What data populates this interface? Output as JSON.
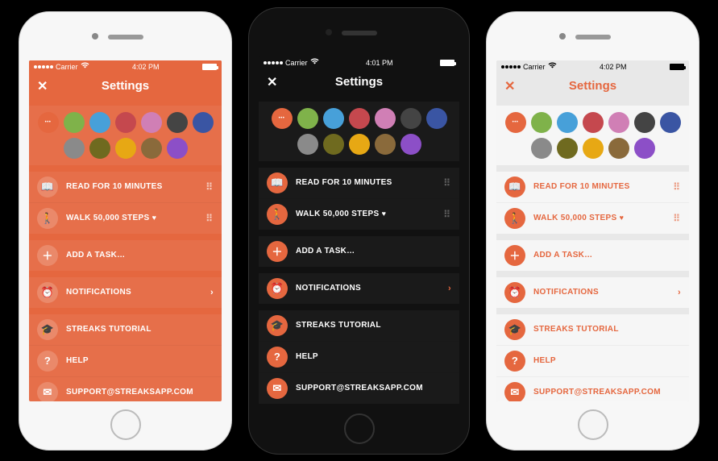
{
  "status": {
    "carrier": "Carrier",
    "wifi_icon": "wifi-icon",
    "battery_icon": "battery-icon"
  },
  "times": {
    "p1": "4:02 PM",
    "p2": "4:01 PM",
    "p3": "4:02 PM"
  },
  "header": {
    "title": "Settings",
    "close_icon": "close-icon"
  },
  "colors": {
    "swatches": [
      {
        "hex": "#e5673f",
        "name": "orange",
        "selected": true
      },
      {
        "hex": "#7fb24a",
        "name": "green"
      },
      {
        "hex": "#47a0d9",
        "name": "blue"
      },
      {
        "hex": "#c5484e",
        "name": "red"
      },
      {
        "hex": "#d07fb5",
        "name": "pink"
      },
      {
        "hex": "#444444",
        "name": "dark-gray"
      },
      {
        "hex": "#3a55a3",
        "name": "navy"
      },
      {
        "hex": "#8a8a8a",
        "name": "gray"
      },
      {
        "hex": "#6f6a1f",
        "name": "olive"
      },
      {
        "hex": "#e7a814",
        "name": "amber"
      },
      {
        "hex": "#8a6a3b",
        "name": "brown"
      },
      {
        "hex": "#8c4fc7",
        "name": "purple"
      }
    ]
  },
  "tasks": [
    {
      "icon": "book-icon",
      "glyph": "📖",
      "label": "READ FOR 10 MINUTES",
      "draggable": true,
      "health": false
    },
    {
      "icon": "walk-icon",
      "glyph": "🚶",
      "label": "WALK 50,000 STEPS",
      "draggable": true,
      "health": true
    }
  ],
  "add_task": {
    "icon": "plus-icon",
    "glyph": "＋",
    "label": "ADD A TASK…"
  },
  "notifications": {
    "icon": "alarm-icon",
    "glyph": "⏰",
    "label": "NOTIFICATIONS"
  },
  "support": [
    {
      "icon": "tutorial-icon",
      "glyph": "🎓",
      "label": "STREAKS TUTORIAL"
    },
    {
      "icon": "help-icon",
      "glyph": "?",
      "label": "HELP"
    },
    {
      "icon": "mail-icon",
      "glyph": "✉",
      "label": "SUPPORT@STREAKSAPP.COM"
    }
  ],
  "heart_glyph": "♥",
  "drag_glyph": "⠿",
  "chevron_glyph": "›"
}
